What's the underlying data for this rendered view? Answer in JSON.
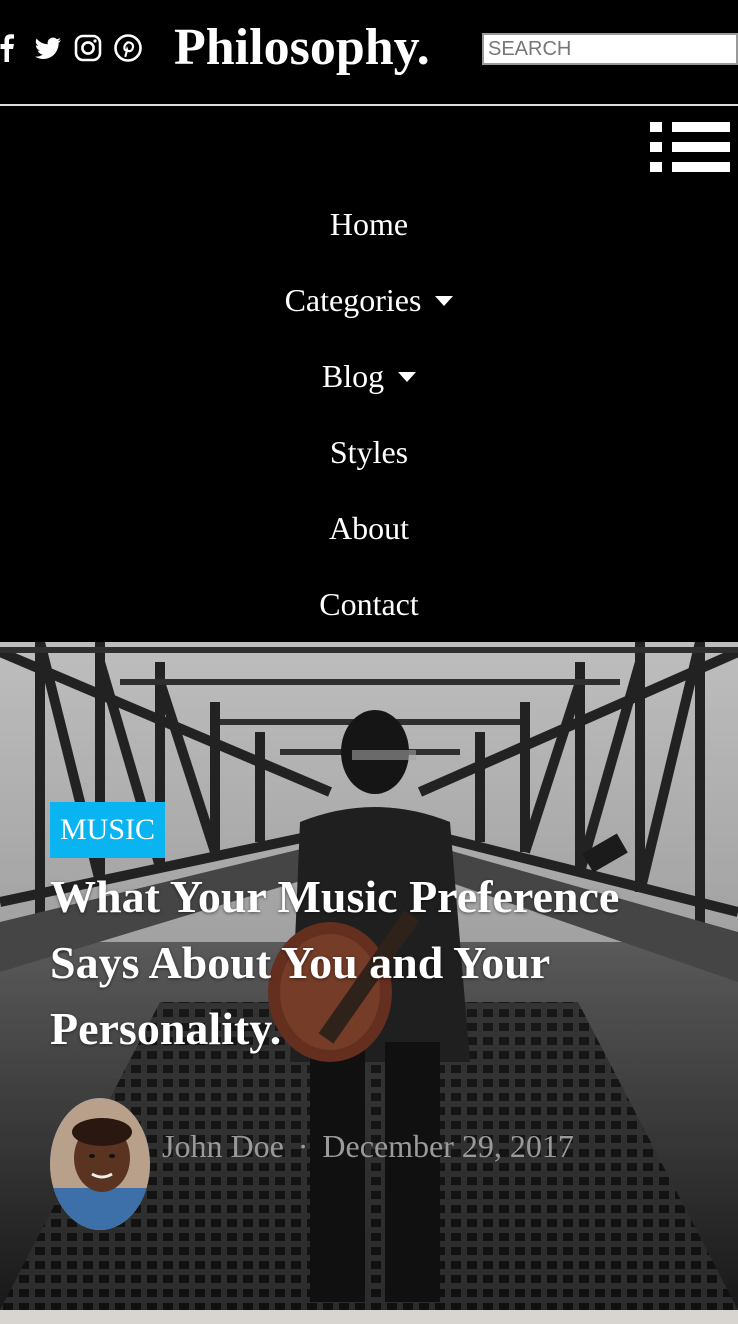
{
  "site": {
    "logo": "Philosophy."
  },
  "social": {
    "icons": [
      "facebook-icon",
      "twitter-icon",
      "instagram-icon",
      "pinterest-icon"
    ]
  },
  "search": {
    "placeholder": "SEARCH"
  },
  "nav": {
    "items": [
      {
        "label": "Home",
        "has_dropdown": false
      },
      {
        "label": "Categories",
        "has_dropdown": true
      },
      {
        "label": "Blog",
        "has_dropdown": true
      },
      {
        "label": "Styles",
        "has_dropdown": false
      },
      {
        "label": "About",
        "has_dropdown": false
      },
      {
        "label": "Contact",
        "has_dropdown": false
      }
    ]
  },
  "hero": {
    "category": "MUSIC",
    "title": "What Your Music Preference Says About You and Your Personality.",
    "author": "John Doe",
    "separator": "·",
    "date": "December 29, 2017"
  },
  "colors": {
    "background": "#000000",
    "category_badge": "#0ab4f0",
    "meta_text": "#9a9a9a"
  }
}
